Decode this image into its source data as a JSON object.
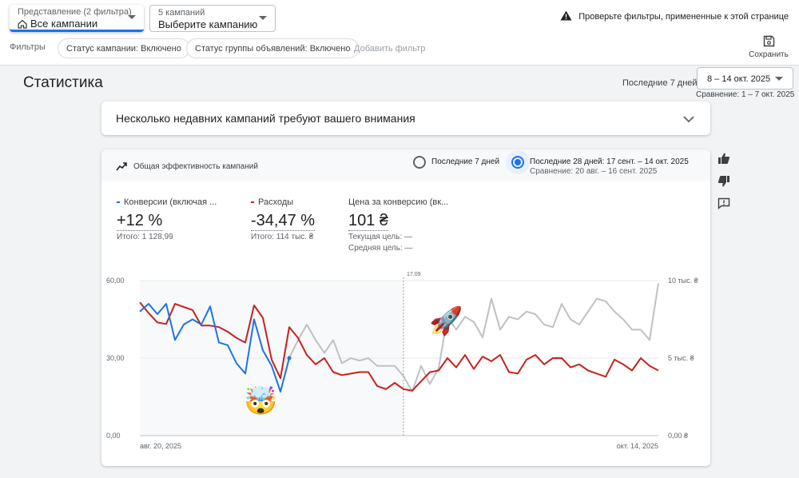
{
  "topbar": {
    "view_select": {
      "label": "Представление (2 фильтра)",
      "value": "Все кампании"
    },
    "campaign_select": {
      "label": "5 кампаний",
      "value": "Выберите кампанию"
    },
    "warning_text": "Проверьте фильтры, примененные к этой странице",
    "filters_label": "Фильтры",
    "chips": [
      "Статус кампании: Включено",
      "Статус группы объявлений: Включено"
    ],
    "add_filter": "Добавить фильтр",
    "save_label": "Сохранить"
  },
  "stats": {
    "title": "Статистика",
    "range_label": "Последние 7 дней",
    "date_range": "8 – 14 окт. 2025",
    "comparison": "Сравнение: 1 – 7 окт. 2025"
  },
  "alert": {
    "text": "Несколько недавних кампаний требуют вашего внимания"
  },
  "card": {
    "title": "Общая эффективность кампаний",
    "radio_7": "Последние 7 дней",
    "radio_28": "Последние 28 дней: 17 сент. – 14 окт. 2025",
    "radio_28_sub": "Сравнение: 20 авг. – 16 сент. 2025",
    "metrics": [
      {
        "name": "Конверсии (включая ...",
        "value": "+12 %",
        "sub1": "Итого: 1 128,99",
        "sub2": "",
        "color": "#1a73e8"
      },
      {
        "name": "Расходы",
        "value": "-34,47 %",
        "sub1": "Итого: 114 тыс. ₴",
        "sub2": "",
        "color": "#c5221f"
      },
      {
        "name": "Цена за конверсию (вк...",
        "value": "101 ₴",
        "sub1": "Текущая цель: —",
        "sub2": "Средняя цель: —",
        "color": ""
      }
    ]
  },
  "chart_data": {
    "type": "line",
    "x_start_label": "авг. 20, 2025",
    "x_end_label": "окт. 14, 2025",
    "divider_label": "17.09",
    "y_left_ticks": [
      "60,00",
      "30,00",
      "0,00"
    ],
    "y_right_ticks": [
      "10 тыс. ₴",
      "5 тыс. ₴",
      "0,00 ₴"
    ],
    "ylim_left": [
      0,
      60
    ],
    "ylim_right": [
      0,
      10000
    ],
    "emojis": [
      "🤯",
      "🚀"
    ],
    "series": [
      {
        "name": "Конверсии (включая ...",
        "color": "#1a73e8",
        "axis": "left",
        "values": [
          48,
          51,
          47,
          51,
          37,
          43,
          45,
          43,
          50,
          36,
          35,
          28,
          24,
          45,
          33,
          27,
          17,
          30
        ]
      },
      {
        "color": "#bdc1c6",
        "axis": "left",
        "values": [
          30,
          37,
          43,
          37,
          32,
          37,
          28,
          30,
          29,
          30,
          27,
          27,
          27,
          23,
          17,
          27,
          20,
          26,
          46,
          41,
          46,
          44,
          38,
          53,
          41,
          46,
          45,
          48,
          47,
          43,
          42,
          51,
          45,
          43,
          48,
          53,
          52,
          48,
          45,
          41,
          41,
          37,
          59
        ]
      },
      {
        "name": "Расходы",
        "color": "#c5221f",
        "axis": "right",
        "values": [
          8600,
          7900,
          7300,
          7200,
          8500,
          8300,
          8100,
          7100,
          7100,
          7000,
          6700,
          6300,
          6000,
          8400,
          7600,
          4900,
          3700,
          7000,
          6300,
          5200,
          4600,
          5000,
          4100,
          3900,
          4000,
          4100,
          4100,
          3200,
          3000,
          3400,
          3000,
          2900,
          3500,
          4100,
          4200,
          5000,
          4400,
          5200,
          4300,
          5100,
          4800,
          5200,
          4100,
          4000,
          4900,
          5200,
          4600,
          5000,
          5000,
          4400,
          4600,
          4200,
          4000,
          3800,
          4900,
          4600,
          4200,
          5000,
          4500,
          4200
        ]
      }
    ]
  }
}
